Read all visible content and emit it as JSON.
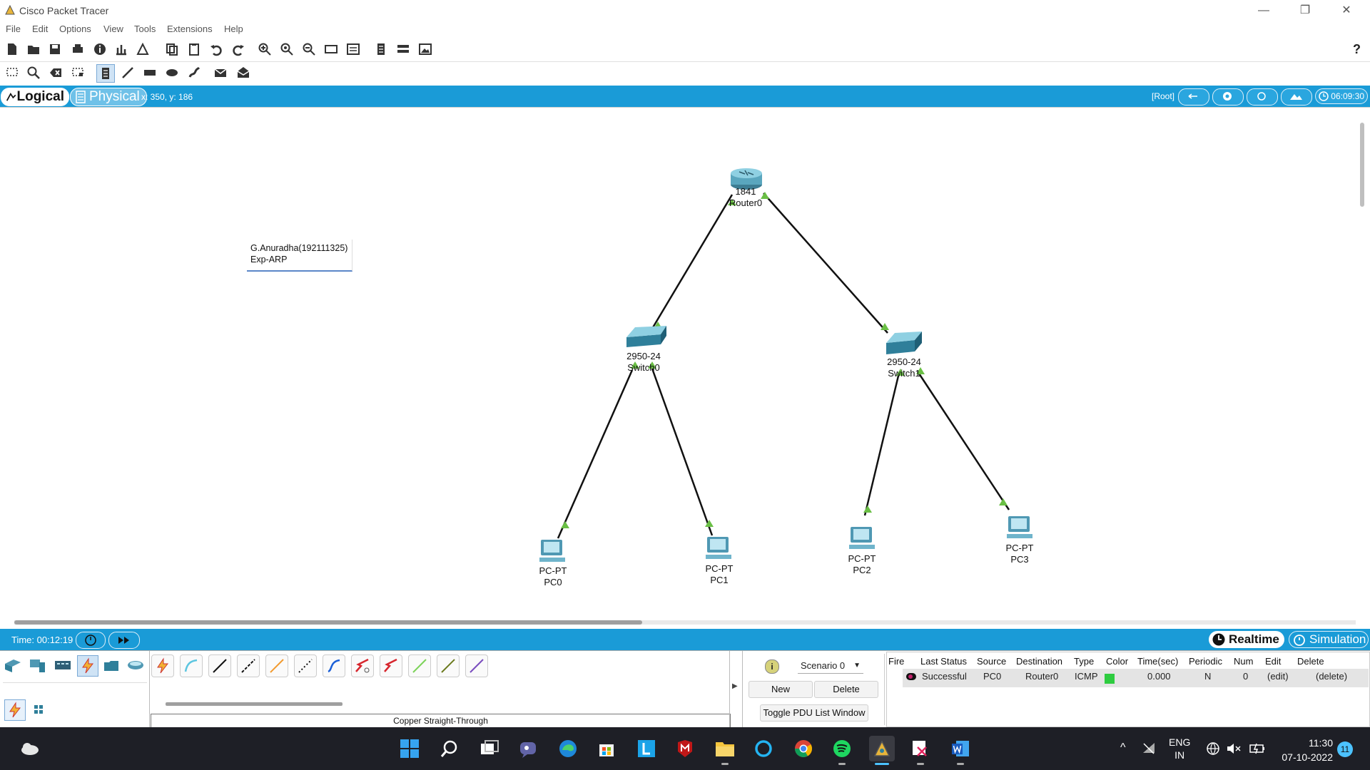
{
  "window": {
    "title": "Cisco Packet Tracer",
    "controls": [
      "—",
      "❐",
      "✕"
    ]
  },
  "menu": {
    "items": [
      "File",
      "Edit",
      "Options",
      "View",
      "Tools",
      "Extensions",
      "Help"
    ]
  },
  "toolbar1": {
    "icons": [
      "new-file-icon",
      "open-folder-icon",
      "save-icon",
      "print-icon",
      "info-icon",
      "activity-wizard-icon",
      "custom-device-icon",
      "copy-icon",
      "paste-icon",
      "undo-icon",
      "redo-icon",
      "zoom-in-icon",
      "zoom-reset-icon",
      "zoom-out-icon",
      "drawing-palette-icon",
      "custom-devices-dialog-icon",
      "notes-icon",
      "device-template-icon",
      "screenshot-icon"
    ],
    "help": "?"
  },
  "toolbar2": {
    "icons": [
      "select-icon",
      "inspect-icon",
      "delete-icon",
      "resize-icon",
      "place-note-icon",
      "draw-line-icon",
      "draw-rectangle-icon",
      "draw-ellipse-icon",
      "freeform-icon",
      "add-simple-pdu-icon",
      "add-complex-pdu-icon"
    ]
  },
  "workspace_bar": {
    "logical": "Logical",
    "physical": "Physical",
    "coords": "x: 350, y: 186",
    "root": "[Root]",
    "clock": "06:09:30"
  },
  "note": {
    "line1": "G.Anuradha(192111325)",
    "line2": "Exp-ARP"
  },
  "devices": [
    {
      "model": "1841",
      "name": "Router0"
    },
    {
      "model": "2950-24",
      "name": "Switch0"
    },
    {
      "model": "2950-24",
      "name": "Switch1"
    },
    {
      "model": "PC-PT",
      "name": "PC0"
    },
    {
      "model": "PC-PT",
      "name": "PC1"
    },
    {
      "model": "PC-PT",
      "name": "PC2"
    },
    {
      "model": "PC-PT",
      "name": "PC3"
    }
  ],
  "timebar": {
    "time": "Time: 00:12:19",
    "realtime": "Realtime",
    "simulation": "Simulation"
  },
  "cable_label": "Copper Straight-Through",
  "scenario": {
    "selected": "Scenario 0",
    "new_label": "New",
    "delete_label": "Delete",
    "toggle_label": "Toggle PDU List Window"
  },
  "pdu_table": {
    "headers": [
      "Fire",
      "Last Status",
      "Source",
      "Destination",
      "Type",
      "Color",
      "Time(sec)",
      "Periodic",
      "Num",
      "Edit",
      "Delete"
    ],
    "rows": [
      {
        "status": "Successful",
        "source": "PC0",
        "destination": "Router0",
        "type": "ICMP",
        "color": "#2ecc40",
        "time": "0.000",
        "periodic": "N",
        "num": "0",
        "edit": "(edit)",
        "delete": "(delete)"
      }
    ]
  },
  "taskbar": {
    "apps": [
      "weather-icon",
      "windows-start-icon",
      "search-icon",
      "task-view-icon",
      "teams-chat-icon",
      "edge-icon",
      "store-icon",
      "l-app-icon",
      "mcafee-icon",
      "file-explorer-icon",
      "cortana-icon",
      "chrome-icon",
      "spotify-icon",
      "packet-tracer-icon",
      "snipping-tool-icon",
      "word-icon"
    ],
    "lang1": "ENG",
    "lang2": "IN",
    "time": "11:30",
    "date": "07-10-2022",
    "notifications": "11"
  },
  "colors": {
    "accent": "#1a9bd7",
    "link_green": "#6abf45",
    "taskbar": "#1e1f26"
  }
}
